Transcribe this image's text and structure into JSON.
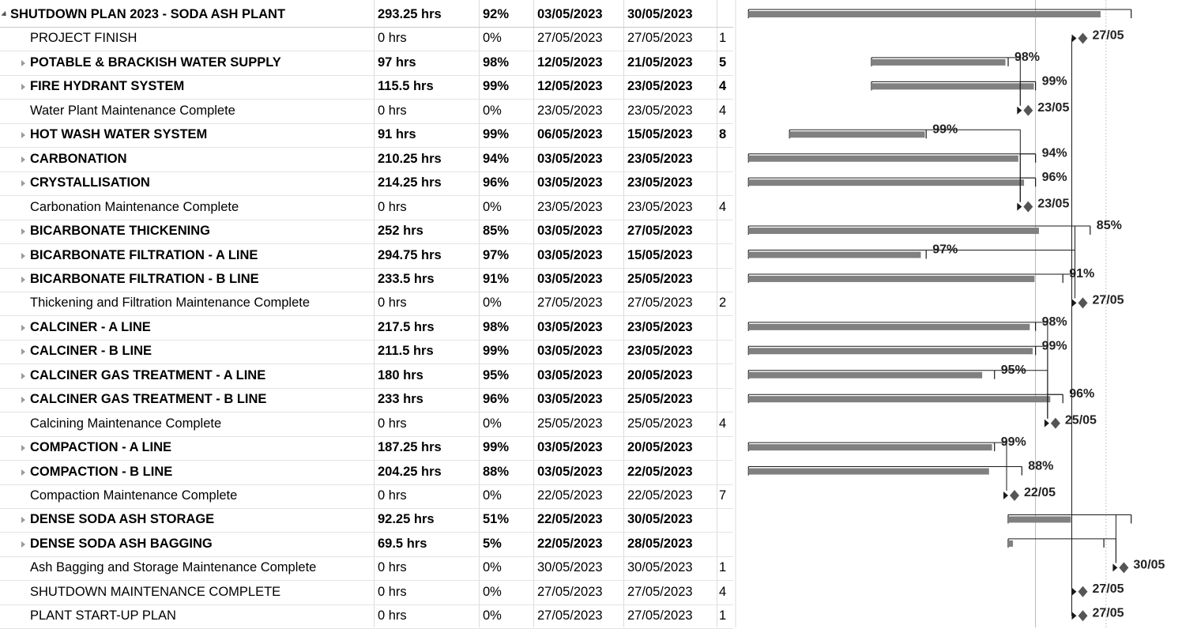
{
  "tasks": [
    {
      "name": "SHUTDOWN PLAN 2023 - SODA ASH PLANT",
      "work": "293.25 hrs",
      "pct": "92%",
      "start": "03/05/2023",
      "finish": "30/05/2023",
      "pred": "",
      "level": 0,
      "type": "summary",
      "expanded": true,
      "pct_value": 0.92
    },
    {
      "name": "PROJECT FINISH",
      "work": "0 hrs",
      "pct": "0%",
      "start": "27/05/2023",
      "finish": "27/05/2023",
      "pred": "1",
      "level": 1,
      "type": "milestone",
      "label": "27/05"
    },
    {
      "name": "POTABLE & BRACKISH WATER SUPPLY",
      "work": "97 hrs",
      "pct": "98%",
      "start": "12/05/2023",
      "finish": "21/05/2023",
      "pred": "5",
      "level": 1,
      "type": "summary",
      "label": "98%",
      "pct_value": 0.98
    },
    {
      "name": "FIRE HYDRANT SYSTEM",
      "work": "115.5 hrs",
      "pct": "99%",
      "start": "12/05/2023",
      "finish": "23/05/2023",
      "pred": "4",
      "level": 1,
      "type": "summary",
      "label": "99%",
      "pct_value": 0.99
    },
    {
      "name": "Water Plant Maintenance Complete",
      "work": "0 hrs",
      "pct": "0%",
      "start": "23/05/2023",
      "finish": "23/05/2023",
      "pred": "4",
      "level": 1,
      "type": "milestone",
      "label": "23/05"
    },
    {
      "name": "HOT WASH WATER SYSTEM",
      "work": "91 hrs",
      "pct": "99%",
      "start": "06/05/2023",
      "finish": "15/05/2023",
      "pred": "8",
      "level": 1,
      "type": "summary",
      "label": "99%",
      "pct_value": 0.99
    },
    {
      "name": "CARBONATION",
      "work": "210.25 hrs",
      "pct": "94%",
      "start": "03/05/2023",
      "finish": "23/05/2023",
      "pred": "",
      "level": 1,
      "type": "summary",
      "label": "94%",
      "pct_value": 0.94
    },
    {
      "name": "CRYSTALLISATION",
      "work": "214.25 hrs",
      "pct": "96%",
      "start": "03/05/2023",
      "finish": "23/05/2023",
      "pred": "",
      "level": 1,
      "type": "summary",
      "label": "96%",
      "pct_value": 0.96
    },
    {
      "name": "Carbonation Maintenance Complete",
      "work": "0 hrs",
      "pct": "0%",
      "start": "23/05/2023",
      "finish": "23/05/2023",
      "pred": "4",
      "level": 1,
      "type": "milestone",
      "label": "23/05"
    },
    {
      "name": "BICARBONATE THICKENING",
      "work": "252 hrs",
      "pct": "85%",
      "start": "03/05/2023",
      "finish": "27/05/2023",
      "pred": "",
      "level": 1,
      "type": "summary",
      "label": "85%",
      "pct_value": 0.85
    },
    {
      "name": "BICARBONATE FILTRATION - A LINE",
      "work": "294.75 hrs",
      "pct": "97%",
      "start": "03/05/2023",
      "finish": "15/05/2023",
      "pred": "",
      "level": 1,
      "type": "summary",
      "label": "97%",
      "pct_value": 0.97
    },
    {
      "name": "BICARBONATE FILTRATION - B LINE",
      "work": "233.5 hrs",
      "pct": "91%",
      "start": "03/05/2023",
      "finish": "25/05/2023",
      "pred": "",
      "level": 1,
      "type": "summary",
      "label": "91%",
      "pct_value": 0.91
    },
    {
      "name": "Thickening and Filtration Maintenance Complete",
      "work": "0 hrs",
      "pct": "0%",
      "start": "27/05/2023",
      "finish": "27/05/2023",
      "pred": "2",
      "level": 1,
      "type": "milestone",
      "label": "27/05"
    },
    {
      "name": "CALCINER - A LINE",
      "work": "217.5 hrs",
      "pct": "98%",
      "start": "03/05/2023",
      "finish": "23/05/2023",
      "pred": "",
      "level": 1,
      "type": "summary",
      "label": "98%",
      "pct_value": 0.98
    },
    {
      "name": "CALCINER - B LINE",
      "work": "211.5 hrs",
      "pct": "99%",
      "start": "03/05/2023",
      "finish": "23/05/2023",
      "pred": "",
      "level": 1,
      "type": "summary",
      "label": "99%",
      "pct_value": 0.99
    },
    {
      "name": "CALCINER GAS TREATMENT - A LINE",
      "work": "180 hrs",
      "pct": "95%",
      "start": "03/05/2023",
      "finish": "20/05/2023",
      "pred": "",
      "level": 1,
      "type": "summary",
      "label": "95%",
      "pct_value": 0.95
    },
    {
      "name": "CALCINER GAS TREATMENT - B LINE",
      "work": "233 hrs",
      "pct": "96%",
      "start": "03/05/2023",
      "finish": "25/05/2023",
      "pred": "",
      "level": 1,
      "type": "summary",
      "label": "96%",
      "pct_value": 0.96
    },
    {
      "name": "Calcining Maintenance Complete",
      "work": "0 hrs",
      "pct": "0%",
      "start": "25/05/2023",
      "finish": "25/05/2023",
      "pred": "4",
      "level": 1,
      "type": "milestone",
      "label": "25/05"
    },
    {
      "name": "COMPACTION - A LINE",
      "work": "187.25 hrs",
      "pct": "99%",
      "start": "03/05/2023",
      "finish": "20/05/2023",
      "pred": "",
      "level": 1,
      "type": "summary",
      "label": "99%",
      "pct_value": 0.99
    },
    {
      "name": "COMPACTION - B LINE",
      "work": "204.25 hrs",
      "pct": "88%",
      "start": "03/05/2023",
      "finish": "22/05/2023",
      "pred": "",
      "level": 1,
      "type": "summary",
      "label": "88%",
      "pct_value": 0.88
    },
    {
      "name": "Compaction Maintenance Complete",
      "work": "0 hrs",
      "pct": "0%",
      "start": "22/05/2023",
      "finish": "22/05/2023",
      "pred": "7",
      "level": 1,
      "type": "milestone",
      "label": "22/05"
    },
    {
      "name": "DENSE SODA ASH STORAGE",
      "work": "92.25 hrs",
      "pct": "51%",
      "start": "22/05/2023",
      "finish": "30/05/2023",
      "pred": "",
      "level": 1,
      "type": "summary",
      "label": "",
      "pct_value": 0.51
    },
    {
      "name": "DENSE SODA ASH BAGGING",
      "work": "69.5 hrs",
      "pct": "5%",
      "start": "22/05/2023",
      "finish": "28/05/2023",
      "pred": "",
      "level": 1,
      "type": "summary",
      "label": "",
      "pct_value": 0.05
    },
    {
      "name": "Ash Bagging and Storage Maintenance Complete",
      "work": "0 hrs",
      "pct": "0%",
      "start": "30/05/2023",
      "finish": "30/05/2023",
      "pred": "1",
      "level": 1,
      "type": "milestone",
      "label": "30/05"
    },
    {
      "name": "SHUTDOWN MAINTENANCE COMPLETE",
      "work": "0 hrs",
      "pct": "0%",
      "start": "27/05/2023",
      "finish": "27/05/2023",
      "pred": "4",
      "level": 1,
      "type": "milestone",
      "label": "27/05"
    },
    {
      "name": "PLANT START-UP PLAN",
      "work": "0 hrs",
      "pct": "0%",
      "start": "27/05/2023",
      "finish": "27/05/2023",
      "pred": "1",
      "level": 1,
      "type": "milestone",
      "label": "27/05"
    }
  ],
  "gantt": {
    "timescale_start": "02/05/2023",
    "timescale_end": "01/06/2023",
    "status_date": "24/05/2023",
    "deadline_date": "27/05/2023",
    "colors": {
      "bar": "#808080",
      "milestone": "#555555",
      "link": "#1a1a1a",
      "status_line": "#9ccc8a",
      "grid": "#dcdcdc"
    }
  }
}
